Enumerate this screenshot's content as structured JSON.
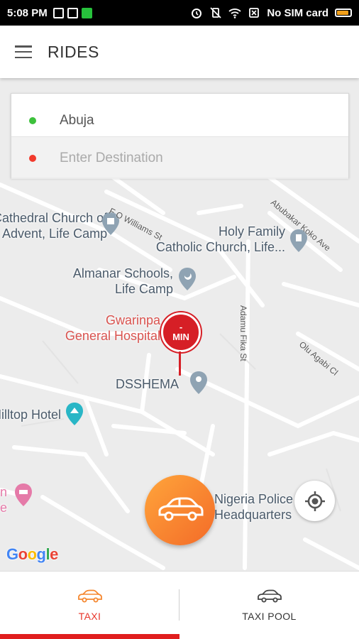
{
  "status_bar": {
    "time": "5:08 PM",
    "carrier": "No SIM card",
    "battery_level": 0.8,
    "battery_color": "#f2a01b"
  },
  "app_bar": {
    "menu_icon": "menu-icon",
    "title": "RIDES"
  },
  "location": {
    "pickup": "Abuja",
    "destination_placeholder": "Enter Destination",
    "destination_value": ""
  },
  "map": {
    "pois": [
      "Cathedral Church of",
      "Advent, Life Camp",
      "Holy Family",
      "Catholic Church, Life...",
      "Almanar Schools,",
      "Life Camp",
      "Gwarinpa",
      "General Hospital",
      "DSSHEMA",
      "Hilltop Hotel",
      "Nigeria Police",
      "Headquarters"
    ],
    "streets": [
      "F O Williams St",
      "Abubakar Koko Ave",
      "Adamu Fika St",
      "Olu Agabi Cl"
    ],
    "pickup_marker": {
      "value": "-",
      "unit": "MIN"
    },
    "attribution": "Google"
  },
  "colors": {
    "accent": "#f36b28",
    "brand_red": "#d61f26",
    "pickup_dot": "#3dc13c",
    "destination_dot": "#f23a2c"
  },
  "tabs": [
    {
      "label": "TAXI",
      "icon": "car-icon",
      "active": true
    },
    {
      "label": "TAXI POOL",
      "icon": "car-icon",
      "active": false
    }
  ]
}
